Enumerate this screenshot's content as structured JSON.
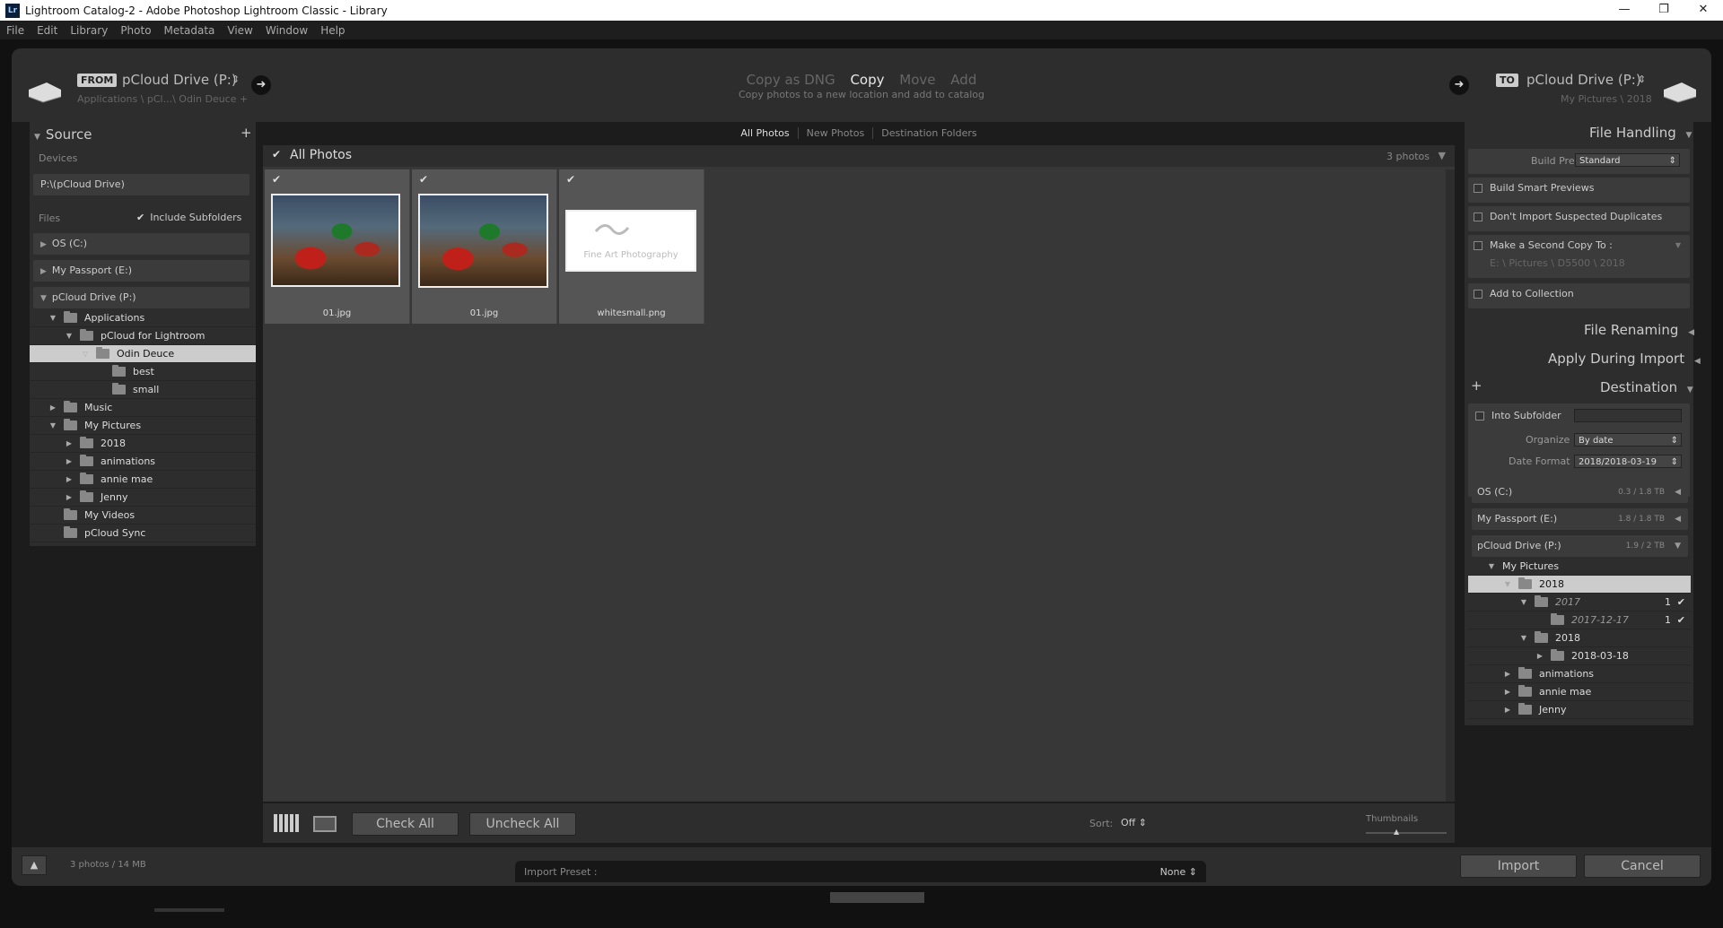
{
  "window": {
    "title": "Lightroom Catalog-2 - Adobe Photoshop Lightroom Classic - Library",
    "logo": "Lr",
    "controls": [
      "—",
      "❐",
      "✕"
    ]
  },
  "menu": [
    "File",
    "Edit",
    "Library",
    "Photo",
    "Metadata",
    "View",
    "Window",
    "Help"
  ],
  "header": {
    "from_tag": "FROM",
    "from_name": "pCloud Drive (P:)",
    "from_path": "Applications \\ pCl...\\ Odin Deuce +",
    "to_tag": "TO",
    "to_name": "pCloud Drive (P:)",
    "to_path": "My Pictures \\ 2018",
    "modes": [
      "Copy as DNG",
      "Copy",
      "Move",
      "Add"
    ],
    "active_mode": "Copy",
    "mode_desc": "Copy photos to a new location and add to catalog"
  },
  "source": {
    "title": "Source",
    "plus": "+",
    "devices_label": "Devices",
    "device": "P:\\(pCloud Drive)",
    "files_label": "Files",
    "include_subfolders": "Include Subfolders",
    "drives": [
      "OS (C:)",
      "My Passport (E:)",
      "pCloud Drive (P:)"
    ],
    "tree": [
      {
        "label": "Applications",
        "level": 0,
        "tri": "▼"
      },
      {
        "label": "pCloud for Lightroom",
        "level": 1,
        "tri": "▼"
      },
      {
        "label": "Odin Deuce",
        "level": 2,
        "tri": "▽"
      },
      {
        "label": "best",
        "level": 3,
        "tri": ""
      },
      {
        "label": "small",
        "level": 3,
        "tri": ""
      },
      {
        "label": "Music",
        "level": 0,
        "tri": "▶"
      },
      {
        "label": "My Pictures",
        "level": 0,
        "tri": "▼"
      },
      {
        "label": "2018",
        "level": 1,
        "tri": "▶"
      },
      {
        "label": "animations",
        "level": 1,
        "tri": "▶"
      },
      {
        "label": "annie mae",
        "level": 1,
        "tri": "▶"
      },
      {
        "label": "Jenny",
        "level": 1,
        "tri": "▶"
      },
      {
        "label": "My Videos",
        "level": 0,
        "tri": ""
      },
      {
        "label": "pCloud Sync",
        "level": 0,
        "tri": ""
      }
    ]
  },
  "tabs": [
    "All Photos",
    "New Photos",
    "Destination Folders"
  ],
  "grid": {
    "header": "All Photos",
    "count": "3 photos",
    "items": [
      {
        "filename": "01.jpg"
      },
      {
        "filename": "01.jpg"
      },
      {
        "filename": "whitesmall.png",
        "caption": "Fine Art Photography"
      }
    ]
  },
  "toolbar": {
    "check_all": "Check All",
    "uncheck_all": "Uncheck All",
    "sort_label": "Sort:",
    "sort_value": "Off",
    "thumbnails_label": "Thumbnails"
  },
  "footer": {
    "summary": "3 photos / 14 MB",
    "preset_label": "Import Preset :",
    "preset_value": "None",
    "import": "Import",
    "cancel": "Cancel"
  },
  "right": {
    "file_handling": "File Handling",
    "build_previews_label": "Build Previews",
    "build_previews_value": "Standard",
    "build_smart": "Build Smart Previews",
    "dont_import": "Don't Import Suspected Duplicates",
    "second_copy": "Make a Second Copy To :",
    "second_copy_path": "E: \\ Pictures \\ D5500 \\ 2018",
    "add_collection": "Add to Collection",
    "file_renaming": "File Renaming",
    "apply_during": "Apply During Import",
    "destination": "Destination",
    "into_subfolder": "Into Subfolder",
    "organize_label": "Organize",
    "organize_value": "By date",
    "date_format_label": "Date Format",
    "date_format_value": "2018/2018-03-19",
    "drives": [
      {
        "name": "OS (C:)",
        "size": "0.3 / 1.8 TB"
      },
      {
        "name": "My Passport (E:)",
        "size": "1.8 / 1.8 TB"
      },
      {
        "name": "pCloud Drive (P:)",
        "size": "1.9 / 2 TB"
      }
    ],
    "tree": [
      {
        "label": "My Pictures",
        "level": 0,
        "tri": "▼",
        "folder": false
      },
      {
        "label": "2018",
        "level": 1,
        "tri": "▼",
        "folder": true
      },
      {
        "label": "2017",
        "level": 2,
        "tri": "▼",
        "folder": true,
        "new": true,
        "count": "1"
      },
      {
        "label": "2017-12-17",
        "level": 3,
        "tri": "",
        "folder": true,
        "new": true,
        "count": "1"
      },
      {
        "label": "2018",
        "level": 2,
        "tri": "▼",
        "folder": true
      },
      {
        "label": "2018-03-18",
        "level": 3,
        "tri": "▶",
        "folder": true
      },
      {
        "label": "animations",
        "level": 1,
        "tri": "▶",
        "folder": true
      },
      {
        "label": "annie mae",
        "level": 1,
        "tri": "▶",
        "folder": true
      },
      {
        "label": "Jenny",
        "level": 1,
        "tri": "▶",
        "folder": true
      }
    ]
  }
}
